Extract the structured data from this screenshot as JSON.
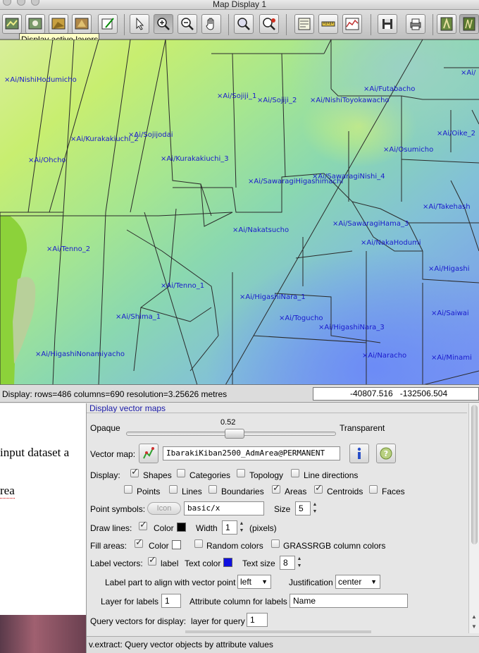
{
  "window": {
    "title": "Map Display 1"
  },
  "toolbar": {
    "tooltip": "Display active layers",
    "buttons": [
      "display-map-icon",
      "render-map-icon",
      "erase-display-icon",
      "decorations-icon",
      "draw-icon",
      "pointer-icon",
      "zoom-in-icon",
      "zoom-out-icon",
      "pan-icon",
      "query-icon",
      "zoom-menu-icon",
      "analyze-icon",
      "measure-icon",
      "profile-icon",
      "save-icon",
      "print-icon",
      "layer-manager-icon",
      "nviz-icon"
    ]
  },
  "map": {
    "labels": [
      "×Ai/NishiHodumicho",
      "×Ai/Sojiji_1",
      "×Ai/Sojiji_2",
      "×Ai/NishiToyokawacho",
      "×Ai/Futabacho",
      "×Ai/",
      "×Ai/Sojijodai",
      "×Ai/KurakakiuchI_2",
      "×Ai/Ohcho",
      "×Ai/Kurakakiuchi_3",
      "×Ai/Oike_2",
      "×Ai/Osumicho",
      "×Ai/SawaragiNishi_4",
      "×Ai/SawaragiHigashimachi",
      "×Ai/Takehash",
      "×Ai/Nakatsucho",
      "×Ai/SawaragiHama_3",
      "×Ai/NakaHodumi",
      "×Ai/Tenno_2",
      "×Ai/Higashi",
      "×Ai/Tenno_1",
      "×Ai/HigashiNara_1",
      "×Ai/Shima_1",
      "×Ai/Togucho",
      "×Ai/Saiwai",
      "×Ai/HigashiNara_3",
      "×Ai/HigashiNonamiyacho",
      "×Ai/Naracho",
      "×Ai/Minami"
    ]
  },
  "statusbar": {
    "text": "Display: rows=486  columns=690  resolution=3.25626 metres",
    "coords": "-40807.516   -132506.504"
  },
  "document": {
    "line1": "input dataset a",
    "line2": "rea"
  },
  "dialog": {
    "header": "Display vector maps",
    "opacity": {
      "opaque_label": "Opaque",
      "transparent_label": "Transparent",
      "value": "0.52"
    },
    "vector_map": {
      "label": "Vector map:",
      "value": "IbarakiKiban2500_AdmArea@PERMANENT"
    },
    "display": {
      "label": "Display:",
      "options": [
        {
          "label": "Shapes",
          "checked": true
        },
        {
          "label": "Categories",
          "checked": false
        },
        {
          "label": "Topology",
          "checked": false
        },
        {
          "label": "Line directions",
          "checked": false
        },
        {
          "label": "Points",
          "checked": false
        },
        {
          "label": "Lines",
          "checked": false
        },
        {
          "label": "Boundaries",
          "checked": false
        },
        {
          "label": "Areas",
          "checked": true
        },
        {
          "label": "Centroids",
          "checked": true
        },
        {
          "label": "Faces",
          "checked": false
        }
      ]
    },
    "point_symbols": {
      "label": "Point symbols:",
      "icon_button": "Icon",
      "value": "basic/x",
      "size_label": "Size",
      "size": "5"
    },
    "draw_lines": {
      "label": "Draw lines:",
      "color_label": "Color",
      "color": "#000000",
      "width_label": "Width",
      "width": "1",
      "unit": "(pixels)"
    },
    "fill_areas": {
      "label": "Fill areas:",
      "color_label": "Color",
      "color": "#ffffff",
      "random_label": "Random colors",
      "grassrgb_label": "GRASSRGB column colors"
    },
    "label_vectors": {
      "label": "Label vectors:",
      "check_label": "label",
      "text_color_label": "Text color",
      "text_color": "#1010e0",
      "text_size_label": "Text size",
      "text_size": "8"
    },
    "label_align": {
      "label": "Label part to align with vector point",
      "value": "left",
      "justification_label": "Justification",
      "justification": "center"
    },
    "layer_labels": {
      "label": "Layer for labels",
      "value": "1",
      "attr_label": "Attribute column for labels",
      "attr_value": "Name"
    },
    "query": {
      "label": "Query vectors for display:",
      "layer_label": "layer for query",
      "value": "1"
    },
    "status": "v.extract: Query vector objects by attribute values"
  }
}
